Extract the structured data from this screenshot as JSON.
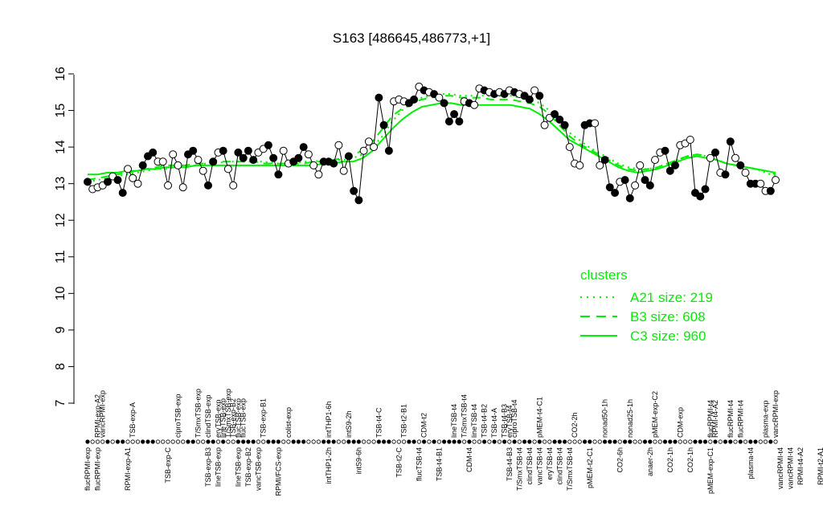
{
  "chart_data": {
    "type": "line",
    "title": "S163 [486645,486773,+1]",
    "xlabel": "",
    "ylabel": "",
    "ylim": [
      7,
      16
    ],
    "y_ticks": [
      7,
      8,
      9,
      10,
      11,
      12,
      13,
      14,
      15,
      16
    ],
    "grid": false,
    "legend_position": "right-middle",
    "top_labels": [
      {
        "i": 2,
        "text": "RPMI-exp-A2"
      },
      {
        "i": 3,
        "text": "vancRPMI-exp"
      },
      {
        "i": 9,
        "text": "TSB-exp-A"
      },
      {
        "i": 18,
        "text": "ciproTSB-exp"
      },
      {
        "i": 22,
        "text": "T/SmxTSB-exp"
      },
      {
        "i": 24,
        "text": "clindTSB-exp"
      },
      {
        "i": 26,
        "text": "eryTSB-exp"
      },
      {
        "i": 27,
        "text": "lineTSB-exp"
      },
      {
        "i": 28,
        "text": "T/SmxTSB-exp"
      },
      {
        "i": 29,
        "text": "TSB-exp-B2"
      },
      {
        "i": 30,
        "text": "flucTSB-exp"
      },
      {
        "i": 31,
        "text": "flucTSB-exp"
      },
      {
        "i": 35,
        "text": "TSB-exp-B1"
      },
      {
        "i": 40,
        "text": "colist-exp"
      },
      {
        "i": 48,
        "text": "intTHP1-6h"
      },
      {
        "i": 52,
        "text": "intS9-2h"
      },
      {
        "i": 58,
        "text": "TSB-t4-C"
      },
      {
        "i": 63,
        "text": "TSB-t2-B1"
      },
      {
        "i": 67,
        "text": "CDM-t2"
      },
      {
        "i": 73,
        "text": "lineTSB-t4"
      },
      {
        "i": 75,
        "text": "T/SmxTSB-t4"
      },
      {
        "i": 77,
        "text": "lineTSB-t4"
      },
      {
        "i": 79,
        "text": "TSB-t4-B2"
      },
      {
        "i": 81,
        "text": "TSB-t4-A"
      },
      {
        "i": 83,
        "text": "TSB-t4-B3"
      },
      {
        "i": 84,
        "text": "eryTSB-t4"
      },
      {
        "i": 85,
        "text": "ciproTSB-t4"
      },
      {
        "i": 90,
        "text": "pMEM-t4-C1"
      },
      {
        "i": 97,
        "text": "CO2-2h"
      },
      {
        "i": 103,
        "text": "nonad50-1h"
      },
      {
        "i": 108,
        "text": "nonad25-1h"
      },
      {
        "i": 113,
        "text": "pMEM-exp-C2"
      },
      {
        "i": 118,
        "text": "CDM-exp"
      },
      {
        "i": 124,
        "text": "flucRPMI-t4"
      },
      {
        "i": 125,
        "text": "RPMI-t4-A2"
      },
      {
        "i": 128,
        "text": "flucRPMI-t4"
      },
      {
        "i": 130,
        "text": "flucRPMI-t4"
      },
      {
        "i": 135,
        "text": "plasma-exp"
      },
      {
        "i": 137,
        "text": "vancRPMI-exp"
      }
    ],
    "bottom_labels": [
      {
        "i": 0,
        "text": "flucRPMI-exp"
      },
      {
        "i": 1,
        "text": "flucRPMI-exp"
      },
      {
        "i": 4,
        "text": "RPMI-exp-A1"
      },
      {
        "i": 8,
        "text": "TSB-exp-C"
      },
      {
        "i": 12,
        "text": "TSB-exp-B3"
      },
      {
        "i": 13,
        "text": "lineTSB-exp"
      },
      {
        "i": 15,
        "text": "lineTSB-exp"
      },
      {
        "i": 16,
        "text": "TSB-exp-B2"
      },
      {
        "i": 17,
        "text": "vancTSB-exp"
      },
      {
        "i": 19,
        "text": "RPMI/FCS-exp"
      },
      {
        "i": 24,
        "text": "intTHP1-2h"
      },
      {
        "i": 27,
        "text": "intS9-6h"
      },
      {
        "i": 31,
        "text": "TSB-t2-C"
      },
      {
        "i": 33,
        "text": "flucTSB-t4"
      },
      {
        "i": 35,
        "text": "TSB-t4-B1"
      },
      {
        "i": 38,
        "text": "CDM-t4"
      },
      {
        "i": 42,
        "text": "TSB-t4-B3"
      },
      {
        "i": 43,
        "text": "T/SmxTSB-t4"
      },
      {
        "i": 44,
        "text": "clindTSB-t4"
      },
      {
        "i": 45,
        "text": "vancTSB-t4"
      },
      {
        "i": 46,
        "text": "eryTSB-t4"
      },
      {
        "i": 47,
        "text": "clindTSB-t4"
      },
      {
        "i": 48,
        "text": "T/SmxTSB-t4"
      },
      {
        "i": 50,
        "text": "pMEM-t2-C1"
      },
      {
        "i": 53,
        "text": "CO2-6h"
      },
      {
        "i": 56,
        "text": "anaer-2h"
      },
      {
        "i": 58,
        "text": "CO2-1h"
      },
      {
        "i": 60,
        "text": "CO2-1h"
      },
      {
        "i": 62,
        "text": "pMEM-exp-C1"
      },
      {
        "i": 66,
        "text": "plasma-t4"
      },
      {
        "i": 69,
        "text": "vancRPMI-t4"
      },
      {
        "i": 70,
        "text": "vancRPMI-t4"
      },
      {
        "i": 71,
        "text": "RPMI-t4-A2"
      },
      {
        "i": 73,
        "text": "RPMI-t2-A1"
      },
      {
        "i": 75,
        "text": "RPMI-exp-A2"
      }
    ],
    "points": [
      [
        0,
        13.05,
        1
      ],
      [
        1,
        12.85,
        0
      ],
      [
        2,
        12.9,
        0
      ],
      [
        3,
        12.95,
        0
      ],
      [
        4,
        13.05,
        1
      ],
      [
        5,
        13.2,
        0
      ],
      [
        6,
        13.1,
        1
      ],
      [
        7,
        12.75,
        1
      ],
      [
        8,
        13.4,
        0
      ],
      [
        9,
        13.15,
        0
      ],
      [
        10,
        13.0,
        0
      ],
      [
        11,
        13.5,
        1
      ],
      [
        12,
        13.75,
        1
      ],
      [
        13,
        13.85,
        1
      ],
      [
        14,
        13.6,
        0
      ],
      [
        15,
        13.6,
        0
      ],
      [
        16,
        12.95,
        0
      ],
      [
        17,
        13.8,
        0
      ],
      [
        18,
        13.5,
        0
      ],
      [
        19,
        12.9,
        0
      ],
      [
        20,
        13.8,
        1
      ],
      [
        21,
        13.9,
        1
      ],
      [
        22,
        13.65,
        0
      ],
      [
        23,
        13.35,
        0
      ],
      [
        24,
        12.95,
        1
      ],
      [
        25,
        13.6,
        1
      ],
      [
        26,
        13.85,
        0
      ],
      [
        27,
        13.9,
        1
      ],
      [
        28,
        13.4,
        0
      ],
      [
        29,
        12.95,
        0
      ],
      [
        30,
        13.85,
        1
      ],
      [
        31,
        13.7,
        1
      ],
      [
        32,
        13.9,
        1
      ],
      [
        33,
        13.65,
        1
      ],
      [
        34,
        13.85,
        0
      ],
      [
        35,
        13.95,
        0
      ],
      [
        36,
        14.05,
        1
      ],
      [
        37,
        13.7,
        1
      ],
      [
        38,
        13.25,
        1
      ],
      [
        39,
        13.9,
        0
      ],
      [
        40,
        13.55,
        0
      ],
      [
        41,
        13.6,
        1
      ],
      [
        42,
        13.7,
        1
      ],
      [
        43,
        14.0,
        1
      ],
      [
        44,
        13.8,
        0
      ],
      [
        45,
        13.5,
        0
      ],
      [
        46,
        13.25,
        0
      ],
      [
        47,
        13.6,
        1
      ],
      [
        48,
        13.6,
        1
      ],
      [
        49,
        13.55,
        1
      ],
      [
        50,
        14.05,
        0
      ],
      [
        51,
        13.35,
        0
      ],
      [
        52,
        13.75,
        1
      ],
      [
        53,
        12.8,
        1
      ],
      [
        54,
        12.55,
        1
      ],
      [
        55,
        13.9,
        0
      ],
      [
        56,
        14.15,
        0
      ],
      [
        57,
        14.0,
        0
      ],
      [
        58,
        15.35,
        1
      ],
      [
        59,
        14.6,
        1
      ],
      [
        60,
        13.9,
        1
      ],
      [
        61,
        15.25,
        0
      ],
      [
        62,
        15.3,
        0
      ],
      [
        63,
        15.25,
        0
      ],
      [
        64,
        15.2,
        1
      ],
      [
        65,
        15.3,
        1
      ],
      [
        66,
        15.65,
        0
      ],
      [
        67,
        15.55,
        1
      ],
      [
        68,
        15.5,
        0
      ],
      [
        69,
        15.45,
        1
      ],
      [
        70,
        15.35,
        0
      ],
      [
        71,
        15.2,
        1
      ],
      [
        72,
        14.7,
        1
      ],
      [
        73,
        14.9,
        1
      ],
      [
        74,
        14.7,
        1
      ],
      [
        75,
        15.25,
        0
      ],
      [
        76,
        15.2,
        1
      ],
      [
        77,
        15.15,
        0
      ],
      [
        78,
        15.6,
        0
      ],
      [
        79,
        15.55,
        1
      ],
      [
        80,
        15.5,
        0
      ],
      [
        81,
        15.45,
        1
      ],
      [
        82,
        15.5,
        0
      ],
      [
        83,
        15.45,
        1
      ],
      [
        84,
        15.55,
        0
      ],
      [
        85,
        15.5,
        1
      ],
      [
        86,
        15.45,
        0
      ],
      [
        87,
        15.4,
        1
      ],
      [
        88,
        15.3,
        1
      ],
      [
        89,
        15.55,
        0
      ],
      [
        90,
        15.4,
        1
      ],
      [
        91,
        14.6,
        0
      ],
      [
        92,
        14.8,
        0
      ],
      [
        93,
        14.9,
        1
      ],
      [
        94,
        14.75,
        1
      ],
      [
        95,
        14.6,
        1
      ],
      [
        96,
        14.0,
        0
      ],
      [
        97,
        13.55,
        0
      ],
      [
        98,
        13.5,
        0
      ],
      [
        99,
        14.6,
        1
      ],
      [
        100,
        14.65,
        1
      ],
      [
        101,
        14.65,
        0
      ],
      [
        102,
        13.5,
        0
      ],
      [
        103,
        13.65,
        1
      ],
      [
        104,
        12.9,
        1
      ],
      [
        105,
        12.75,
        1
      ],
      [
        106,
        13.05,
        0
      ],
      [
        107,
        13.1,
        1
      ],
      [
        108,
        12.6,
        1
      ],
      [
        109,
        12.95,
        0
      ],
      [
        110,
        13.5,
        0
      ],
      [
        111,
        13.1,
        1
      ],
      [
        112,
        12.95,
        1
      ],
      [
        113,
        13.65,
        0
      ],
      [
        114,
        13.85,
        0
      ],
      [
        115,
        13.9,
        1
      ],
      [
        116,
        13.35,
        1
      ],
      [
        117,
        13.5,
        1
      ],
      [
        118,
        14.05,
        0
      ],
      [
        119,
        14.1,
        0
      ],
      [
        120,
        14.2,
        0
      ],
      [
        121,
        12.75,
        1
      ],
      [
        122,
        12.65,
        1
      ],
      [
        123,
        12.85,
        1
      ],
      [
        124,
        13.7,
        0
      ],
      [
        125,
        13.85,
        1
      ],
      [
        126,
        13.3,
        0
      ],
      [
        127,
        13.25,
        1
      ],
      [
        128,
        14.15,
        1
      ],
      [
        129,
        13.7,
        0
      ],
      [
        130,
        13.5,
        1
      ],
      [
        131,
        13.3,
        0
      ],
      [
        132,
        13.0,
        1
      ],
      [
        133,
        13.0,
        1
      ],
      [
        134,
        13.0,
        0
      ],
      [
        135,
        12.8,
        0
      ],
      [
        136,
        12.8,
        1
      ],
      [
        137,
        13.1,
        0
      ]
    ],
    "series": [
      {
        "name": "A21 size: 219",
        "style": "dotted",
        "values": [
          13.05,
          13.1,
          13.15,
          13.2,
          13.25,
          13.3,
          13.35,
          13.4,
          13.4,
          13.45,
          13.45,
          13.5,
          13.55,
          13.55,
          13.6,
          13.6,
          13.6,
          13.6,
          13.6,
          13.55,
          13.55,
          13.55,
          13.6,
          13.6,
          13.65,
          13.65,
          13.65,
          13.7,
          13.8,
          14.0,
          14.3,
          14.7,
          15.0,
          15.2,
          15.35,
          15.4,
          15.45,
          15.45,
          15.4,
          15.4,
          15.4,
          15.4,
          15.4,
          15.4,
          15.35,
          15.3,
          15.2,
          15.0,
          14.7,
          14.4,
          14.2,
          14.0,
          13.85,
          13.7,
          13.55,
          13.45,
          13.4,
          13.4,
          13.45,
          13.55,
          13.65,
          13.75,
          13.8,
          13.75,
          13.65,
          13.55,
          13.5,
          13.45,
          13.4,
          13.3,
          13.2
        ]
      },
      {
        "name": "B3 size: 608",
        "style": "dashed",
        "values": [
          13.1,
          13.15,
          13.2,
          13.25,
          13.3,
          13.35,
          13.4,
          13.45,
          13.5,
          13.5,
          13.5,
          13.55,
          13.55,
          13.6,
          13.6,
          13.6,
          13.6,
          13.6,
          13.55,
          13.55,
          13.55,
          13.55,
          13.55,
          13.6,
          13.6,
          13.65,
          13.7,
          13.8,
          13.9,
          14.15,
          14.5,
          14.85,
          15.05,
          15.2,
          15.3,
          15.35,
          15.4,
          15.4,
          15.35,
          15.35,
          15.35,
          15.3,
          15.3,
          15.3,
          15.25,
          15.2,
          15.1,
          14.9,
          14.6,
          14.3,
          14.1,
          13.95,
          13.8,
          13.65,
          13.5,
          13.4,
          13.35,
          13.4,
          13.45,
          13.55,
          13.65,
          13.75,
          13.8,
          13.75,
          13.65,
          13.55,
          13.5,
          13.45,
          13.4,
          13.35,
          13.25
        ]
      },
      {
        "name": "C3 size: 960",
        "style": "solid",
        "values": [
          13.25,
          13.25,
          13.3,
          13.3,
          13.35,
          13.35,
          13.4,
          13.4,
          13.45,
          13.45,
          13.45,
          13.5,
          13.5,
          13.5,
          13.5,
          13.5,
          13.5,
          13.5,
          13.5,
          13.5,
          13.5,
          13.5,
          13.5,
          13.5,
          13.55,
          13.55,
          13.6,
          13.6,
          13.7,
          13.9,
          14.2,
          14.5,
          14.75,
          14.95,
          15.1,
          15.15,
          15.2,
          15.2,
          15.15,
          15.15,
          15.15,
          15.15,
          15.15,
          15.15,
          15.1,
          15.05,
          14.9,
          14.7,
          14.45,
          14.2,
          14.05,
          13.9,
          13.75,
          13.6,
          13.45,
          13.35,
          13.3,
          13.35,
          13.4,
          13.5,
          13.6,
          13.7,
          13.75,
          13.7,
          13.65,
          13.55,
          13.5,
          13.45,
          13.4,
          13.35,
          13.3
        ]
      }
    ],
    "legend_title": "clusters",
    "colors": {
      "line": "#000000",
      "cluster": "#00ee00"
    }
  }
}
